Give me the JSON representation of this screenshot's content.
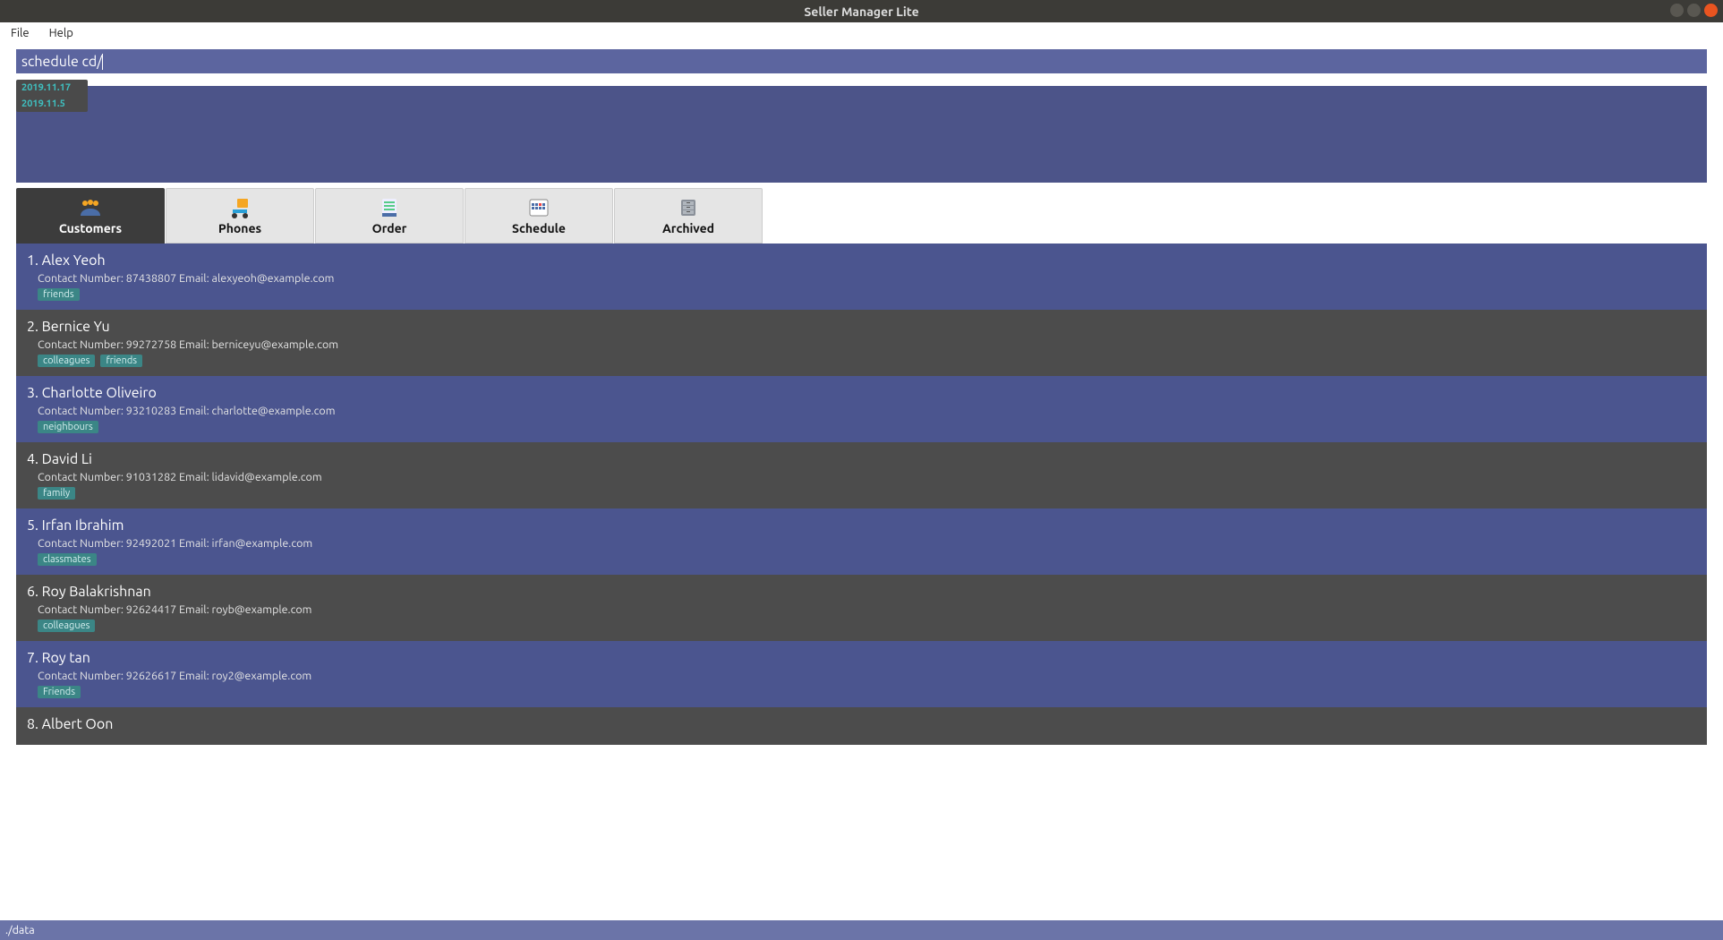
{
  "window": {
    "title": "Seller Manager Lite"
  },
  "menubar": {
    "file": "File",
    "help": "Help"
  },
  "command_input": {
    "value": "schedule cd/"
  },
  "autocomplete": {
    "items": [
      "2019.11.17",
      "2019.11.5"
    ]
  },
  "tabs": {
    "customers": "Customers",
    "phones": "Phones",
    "order": "Order",
    "schedule": "Schedule",
    "archived": "Archived"
  },
  "customers": [
    {
      "idx": "1.",
      "name": "Alex Yeoh",
      "contact": "87438807",
      "email": "alexyeoh@example.com",
      "tags": [
        "friends"
      ]
    },
    {
      "idx": "2.",
      "name": "Bernice Yu",
      "contact": "99272758",
      "email": "berniceyu@example.com",
      "tags": [
        "colleagues",
        "friends"
      ]
    },
    {
      "idx": "3.",
      "name": "Charlotte Oliveiro",
      "contact": "93210283",
      "email": "charlotte@example.com",
      "tags": [
        "neighbours"
      ]
    },
    {
      "idx": "4.",
      "name": "David Li",
      "contact": "91031282",
      "email": "lidavid@example.com",
      "tags": [
        "family"
      ]
    },
    {
      "idx": "5.",
      "name": "Irfan Ibrahim",
      "contact": "92492021",
      "email": "irfan@example.com",
      "tags": [
        "classmates"
      ]
    },
    {
      "idx": "6.",
      "name": "Roy Balakrishnan",
      "contact": "92624417",
      "email": "royb@example.com",
      "tags": [
        "colleagues"
      ]
    },
    {
      "idx": "7.",
      "name": "Roy tan",
      "contact": "92626617",
      "email": "roy2@example.com",
      "tags": [
        "Friends"
      ]
    },
    {
      "idx": "8.",
      "name": "Albert Oon",
      "contact": "",
      "email": "",
      "tags": []
    }
  ],
  "labels": {
    "contact_number": "Contact Number:",
    "email": "Email:"
  },
  "statusbar": {
    "text": "./data"
  }
}
